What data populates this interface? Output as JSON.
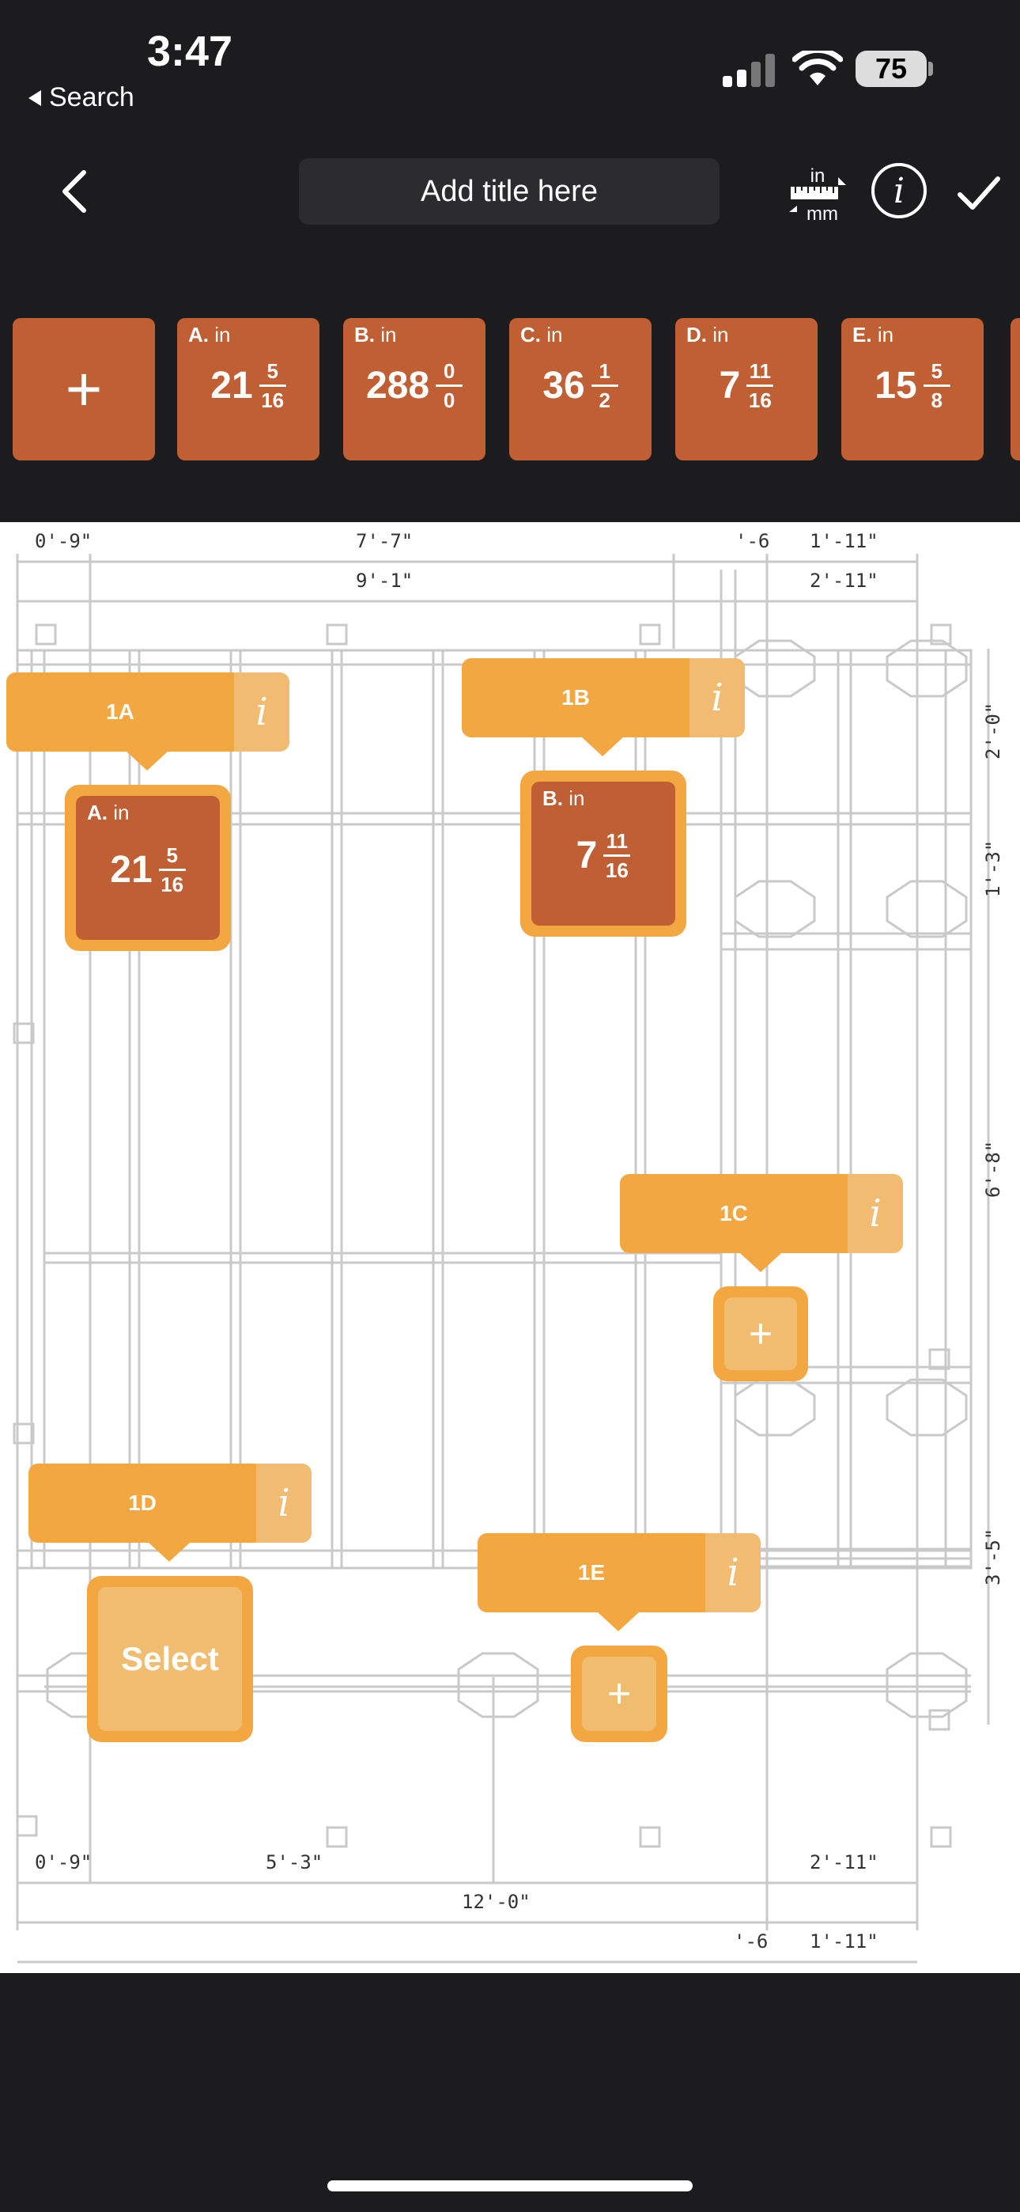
{
  "status_bar": {
    "time": "3:47",
    "back_app": "Search",
    "battery": "75",
    "icons": [
      "signal-icon",
      "wifi-icon",
      "battery-icon"
    ]
  },
  "header": {
    "title_placeholder": "Add title here",
    "unit_toggle_top": "in",
    "unit_toggle_bottom": "mm",
    "info_label": "i",
    "icons": [
      "back-chevron-icon",
      "unit-toggle-icon",
      "info-icon",
      "checkmark-icon"
    ]
  },
  "tiles": {
    "add_label": "+",
    "unit": "in",
    "items": [
      {
        "letter": "A.",
        "whole": "21",
        "num": "5",
        "den": "16"
      },
      {
        "letter": "B.",
        "whole": "288",
        "num": "0",
        "den": "0"
      },
      {
        "letter": "C.",
        "whole": "36",
        "num": "1",
        "den": "2"
      },
      {
        "letter": "D.",
        "whole": "7",
        "num": "11",
        "den": "16"
      },
      {
        "letter": "E.",
        "whole": "15",
        "num": "5",
        "den": "8"
      }
    ]
  },
  "drawing": {
    "dims_top_1": [
      "0'-9\"",
      "7'-7\"",
      "'-6",
      "1'-11\""
    ],
    "dims_top_2": [
      "9'-1\"",
      "2'-11\""
    ],
    "dims_right": [
      "2'-0\"",
      "1'-3\"",
      "6'-8\"",
      "3'-5\""
    ],
    "dims_bottom_1": [
      "0'-9\"",
      "5'-3\"",
      "2'-11\""
    ],
    "dims_bottom_2": [
      "12'-0\""
    ],
    "dims_bottom_3": [
      "'-6",
      "1'-11\""
    ]
  },
  "tags": [
    {
      "id": "1A",
      "info": "i",
      "slot": {
        "type": "filled",
        "letter": "A.",
        "unit": "in",
        "whole": "21",
        "num": "5",
        "den": "16"
      }
    },
    {
      "id": "1B",
      "info": "i",
      "slot": {
        "type": "filled",
        "letter": "B.",
        "unit": "in",
        "whole": "7",
        "num": "11",
        "den": "16"
      }
    },
    {
      "id": "1C",
      "info": "i",
      "slot": {
        "type": "empty",
        "label": "+"
      }
    },
    {
      "id": "1D",
      "info": "i",
      "slot": {
        "type": "select",
        "label": "Select"
      }
    },
    {
      "id": "1E",
      "info": "i",
      "slot": {
        "type": "empty",
        "label": "+"
      }
    }
  ],
  "colors": {
    "background": "#1c1c1e",
    "tile": "#c05f34",
    "tag": "#f3a741",
    "tag_light": "#f0bd70"
  }
}
